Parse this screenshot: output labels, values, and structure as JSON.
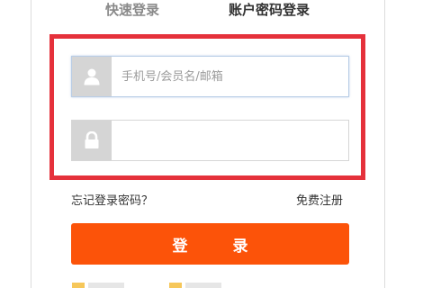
{
  "tabs": {
    "quick_login": "快速登录",
    "account_login": "账户密码登录"
  },
  "form": {
    "username": {
      "icon": "user-icon",
      "placeholder": "手机号/会员名/邮箱",
      "value": ""
    },
    "password": {
      "icon": "lock-icon",
      "placeholder": "",
      "value": ""
    }
  },
  "links": {
    "forgot_password": "忘记登录密码？",
    "register": "免费注册"
  },
  "login_button": "登 录",
  "colors": {
    "highlight_border": "#e5313b",
    "login_button": "#fc5309",
    "icon_background": "#d5d5d5"
  }
}
